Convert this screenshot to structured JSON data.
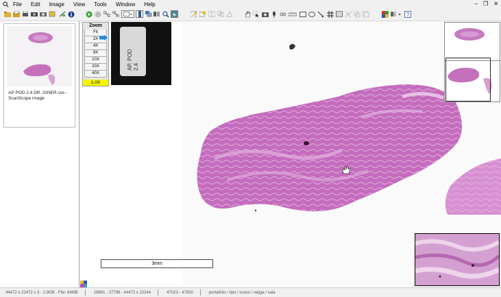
{
  "menu": {
    "items": [
      "File",
      "Edit",
      "Image",
      "View",
      "Tools",
      "Window",
      "Help"
    ]
  },
  "window_controls": {
    "minimize": "–",
    "restore": "❐",
    "close": "✕"
  },
  "thumbnail": {
    "caption": "AP POD 2.4 DR. GINER.svs - ScanScope image"
  },
  "zoom_panel": {
    "title": "Zoom",
    "levels": [
      "Fit",
      "2X",
      "4X",
      "8X",
      "10X",
      "20X",
      "40X"
    ],
    "current": "1.0X"
  },
  "slide_label": {
    "text": "AP. POD\n2.4"
  },
  "scale_bar": {
    "label": "3mm"
  },
  "status": {
    "dimensions": "44472 x 22472 x 3 - 2.9GB - File: 64MB",
    "region": "18981 - 27798 : 44472 x 22244",
    "coords": "47023 - 47930",
    "description": "portafolio / tipo / scans / vejiga / sala"
  },
  "colors": {
    "tissue": "#c46cbe",
    "tissue_light": "#e3b4de",
    "highlight": "#f5f500",
    "zoom_arrow": "#1e8ce0"
  }
}
